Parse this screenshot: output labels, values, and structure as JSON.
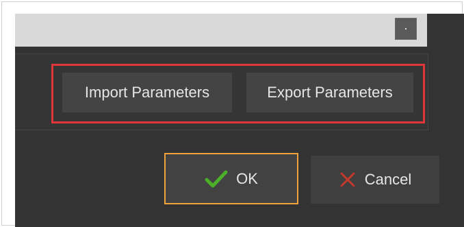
{
  "dialog": {
    "import_label": "Import Parameters",
    "export_label": "Export Parameters",
    "ok_label": "OK",
    "cancel_label": "Cancel"
  },
  "icons": {
    "ok": "checkmark-icon",
    "cancel": "close-icon",
    "scroll": "scroll-button-icon"
  },
  "colors": {
    "highlight": "#e3363c",
    "ok_border": "#f2a23a",
    "ok_check": "#4caf2a",
    "cancel_x": "#c0392b"
  }
}
